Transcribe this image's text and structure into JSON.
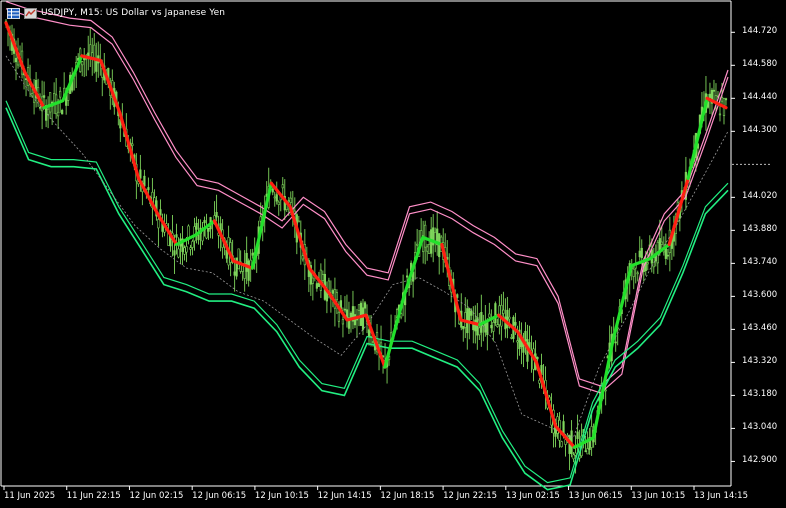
{
  "window": {
    "title": "USDJPY, M15:  US Dollar vs Japanese Yen",
    "icons": [
      "chart-grid-icon",
      "one-click-trading-icon"
    ]
  },
  "colors": {
    "background": "#000000",
    "candles": "#7fd65c",
    "upper_band": "#ff8fc8",
    "lower_band": "#22ef82",
    "trend_up": "#22e12b",
    "trend_down": "#ff1f12",
    "midline": "#9a9a9a",
    "axis": "#ffffff"
  },
  "chart_data": {
    "type": "candlestick",
    "symbol": "USDJPY",
    "timeframe": "M15",
    "ylim": [
      142.8,
      144.84
    ],
    "y_ticks": [
      "144.720",
      "144.580",
      "144.440",
      "144.300",
      "144.020",
      "143.880",
      "143.740",
      "143.600",
      "143.460",
      "143.320",
      "143.180",
      "143.040",
      "142.900"
    ],
    "current_price": 144.16,
    "x_ticks": [
      "11 Jun 2025",
      "11 Jun 22:15",
      "12 Jun 02:15",
      "12 Jun 06:15",
      "12 Jun 10:15",
      "12 Jun 14:15",
      "12 Jun 18:15",
      "12 Jun 22:15",
      "13 Jun 02:15",
      "13 Jun 06:15",
      "13 Jun 10:15",
      "13 Jun 14:15"
    ],
    "close_path": [
      144.76,
      144.55,
      144.4,
      144.43,
      144.62,
      144.6,
      144.38,
      144.1,
      143.95,
      143.82,
      143.86,
      143.92,
      143.75,
      143.72,
      144.08,
      143.98,
      143.72,
      143.62,
      143.5,
      143.52,
      143.3,
      143.6,
      143.85,
      143.82,
      143.5,
      143.48,
      143.52,
      143.45,
      143.32,
      143.05,
      142.96,
      143.0,
      143.4,
      143.73,
      143.76,
      143.82,
      144.1,
      144.44,
      144.4
    ],
    "trend_segments": [
      {
        "dir": "down",
        "from": 0,
        "to": 2
      },
      {
        "dir": "up",
        "from": 2,
        "to": 4
      },
      {
        "dir": "down",
        "from": 4,
        "to": 9
      },
      {
        "dir": "up",
        "from": 9,
        "to": 11
      },
      {
        "dir": "down",
        "from": 11,
        "to": 13
      },
      {
        "dir": "up",
        "from": 13,
        "to": 14
      },
      {
        "dir": "down",
        "from": 14,
        "to": 20
      },
      {
        "dir": "up",
        "from": 20,
        "to": 23
      },
      {
        "dir": "down",
        "from": 23,
        "to": 25
      },
      {
        "dir": "up",
        "from": 25,
        "to": 26
      },
      {
        "dir": "down",
        "from": 26,
        "to": 30
      },
      {
        "dir": "up",
        "from": 30,
        "to": 35
      },
      {
        "dir": "down",
        "from": 35,
        "to": 36
      },
      {
        "dir": "up",
        "from": 36,
        "to": 37
      },
      {
        "dir": "down",
        "from": 37,
        "to": 38
      }
    ],
    "upper_band": [
      144.85,
      144.82,
      144.8,
      144.78,
      144.77,
      144.7,
      144.55,
      144.38,
      144.22,
      144.1,
      144.08,
      144.03,
      143.98,
      143.92,
      144.02,
      143.96,
      143.82,
      143.72,
      143.7,
      143.98,
      144.0,
      143.96,
      143.9,
      143.85,
      143.78,
      143.76,
      143.6,
      143.25,
      143.22,
      143.3,
      143.75,
      143.95,
      144.05,
      144.3,
      144.56
    ],
    "lower_band": [
      144.4,
      144.18,
      144.15,
      144.15,
      144.14,
      143.95,
      143.8,
      143.65,
      143.62,
      143.58,
      143.58,
      143.55,
      143.45,
      143.3,
      143.2,
      143.18,
      143.4,
      143.38,
      143.38,
      143.34,
      143.3,
      143.2,
      143.0,
      142.85,
      142.78,
      142.8,
      143.12,
      143.3,
      143.38,
      143.48,
      143.7,
      143.95,
      144.05
    ],
    "midline": [
      144.62,
      144.45,
      144.32,
      144.2,
      144.05,
      143.9,
      143.8,
      143.72,
      143.7,
      143.62,
      143.58,
      143.5,
      143.42,
      143.35,
      143.48,
      143.65,
      143.68,
      143.62,
      143.55,
      143.4,
      143.1,
      143.05,
      143.0,
      143.3,
      143.5,
      143.72,
      143.9,
      144.1,
      144.3
    ]
  }
}
